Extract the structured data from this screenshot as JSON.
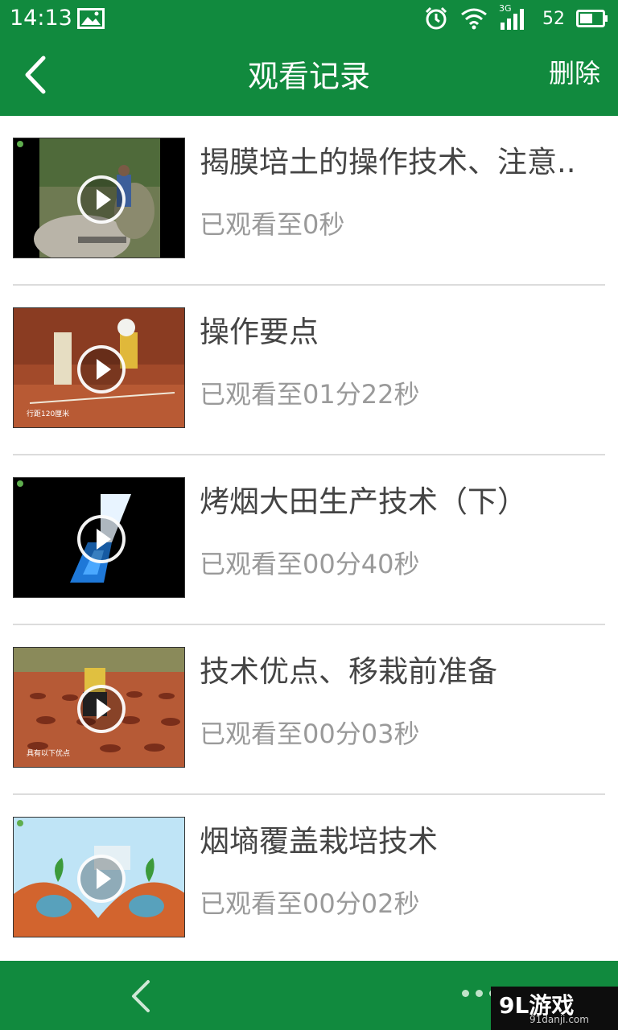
{
  "status_bar": {
    "time": "14:13",
    "network": "3G",
    "battery": "52"
  },
  "app_bar": {
    "title": "观看记录",
    "delete_label": "删除"
  },
  "records": [
    {
      "title": "揭膜培土的操作技术、注意..",
      "progress": "已观看至0秒",
      "thumb_caption": ""
    },
    {
      "title": "操作要点",
      "progress": "已观看至01分22秒",
      "thumb_caption": "行距120厘米"
    },
    {
      "title": "烤烟大田生产技术（下）",
      "progress": "已观看至00分40秒",
      "thumb_caption": ""
    },
    {
      "title": "技术优点、移栽前准备",
      "progress": "已观看至00分03秒",
      "thumb_caption": "具有以下优点"
    },
    {
      "title": "烟墒覆盖栽培技术",
      "progress": "已观看至00分02秒",
      "thumb_caption": ""
    }
  ],
  "watermark": {
    "brand": "9L游戏",
    "url": "91danji.com"
  },
  "colors": {
    "primary_green": "#118a3e",
    "title_text": "#444444",
    "secondary_text": "#9a9a9a"
  }
}
